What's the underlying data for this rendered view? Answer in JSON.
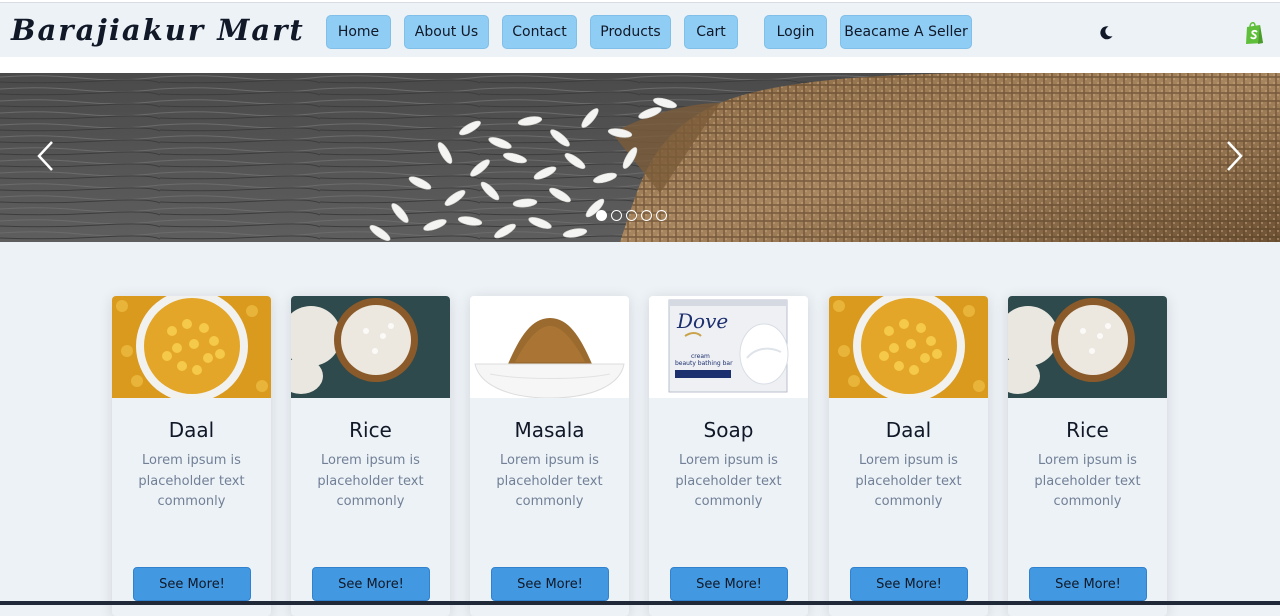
{
  "brand": {
    "name": "Barajiakur Mart"
  },
  "nav": {
    "items": [
      "Home",
      "About Us",
      "Contact",
      "Products",
      "Cart",
      "Login",
      "Beacame A Seller"
    ],
    "theme_toggle_icon": "moon-icon",
    "shop_icon": "shopify-bag-icon"
  },
  "banner": {
    "slide_count": 5,
    "active_slide": 1,
    "prev_icon": "chevron-left-icon",
    "next_icon": "chevron-right-icon"
  },
  "products": [
    {
      "title": "Daal",
      "text": "Lorem ipsum is placeholder text commonly",
      "button": "See More!"
    },
    {
      "title": "Rice",
      "text": "Lorem ipsum is placeholder text commonly",
      "button": "See More!"
    },
    {
      "title": "Masala",
      "text": "Lorem ipsum is placeholder text commonly",
      "button": "See More!"
    },
    {
      "title": "Soap",
      "text": "Lorem ipsum is placeholder text commonly",
      "button": "See More!"
    },
    {
      "title": "Daal",
      "text": "Lorem ipsum is placeholder text commonly",
      "button": "See More!"
    },
    {
      "title": "Rice",
      "text": "Lorem ipsum is placeholder text commonly",
      "button": "See More!"
    }
  ],
  "soap_package": {
    "brand": "Dove",
    "line1": "cream",
    "line2": "beauty bathing bar"
  },
  "colors": {
    "nav_button": "#90cdf4",
    "primary_button": "#4299e1",
    "page_bg": "#edf2f7",
    "shop_icon": "#5fbf3a"
  }
}
